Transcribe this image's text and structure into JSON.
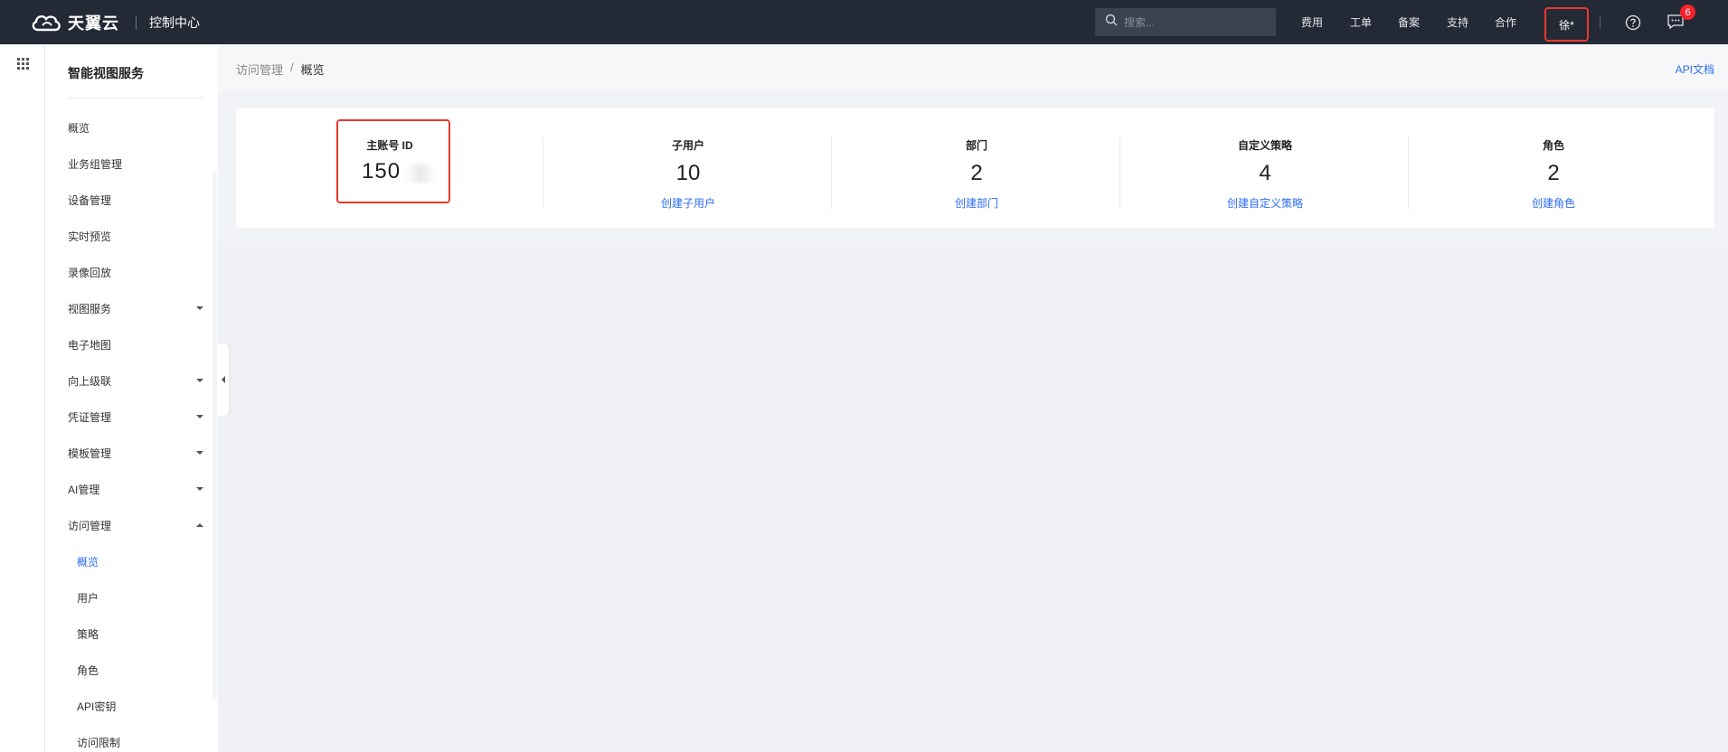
{
  "header": {
    "brand_name": "天翼云",
    "console_title": "控制中心",
    "search_placeholder": "搜索...",
    "nav": [
      "费用",
      "工单",
      "备案",
      "支持",
      "合作"
    ],
    "user_label": "徐*",
    "message_count": "6"
  },
  "sidebar": {
    "title": "智能视图服务",
    "items": [
      {
        "label": "概览"
      },
      {
        "label": "业务组管理"
      },
      {
        "label": "设备管理"
      },
      {
        "label": "实时预览"
      },
      {
        "label": "录像回放"
      },
      {
        "label": "视图服务"
      },
      {
        "label": "电子地图"
      },
      {
        "label": "向上级联"
      },
      {
        "label": "凭证管理"
      },
      {
        "label": "模板管理"
      },
      {
        "label": "AI管理"
      },
      {
        "label": "访问管理"
      }
    ],
    "sub_items": [
      {
        "label": "概览"
      },
      {
        "label": "用户"
      },
      {
        "label": "策略"
      },
      {
        "label": "角色"
      },
      {
        "label": "API密钥"
      },
      {
        "label": "访问限制"
      }
    ]
  },
  "breadcrumb": {
    "parent": "访问管理",
    "separator": "/",
    "current": "概览"
  },
  "api_doc_link": "API文档",
  "stats": {
    "account": {
      "title": "主账号 ID",
      "value": "150"
    },
    "subusers": {
      "title": "子用户",
      "value": "10",
      "link": "创建子用户"
    },
    "departments": {
      "title": "部门",
      "value": "2",
      "link": "创建部门"
    },
    "policies": {
      "title": "自定义策略",
      "value": "4",
      "link": "创建自定义策略"
    },
    "roles": {
      "title": "角色",
      "value": "2",
      "link": "创建角色"
    }
  },
  "colors": {
    "topbar": "#242936",
    "accent": "#2d6cf5",
    "highlight": "#e8392b",
    "badge": "#f5222d"
  }
}
